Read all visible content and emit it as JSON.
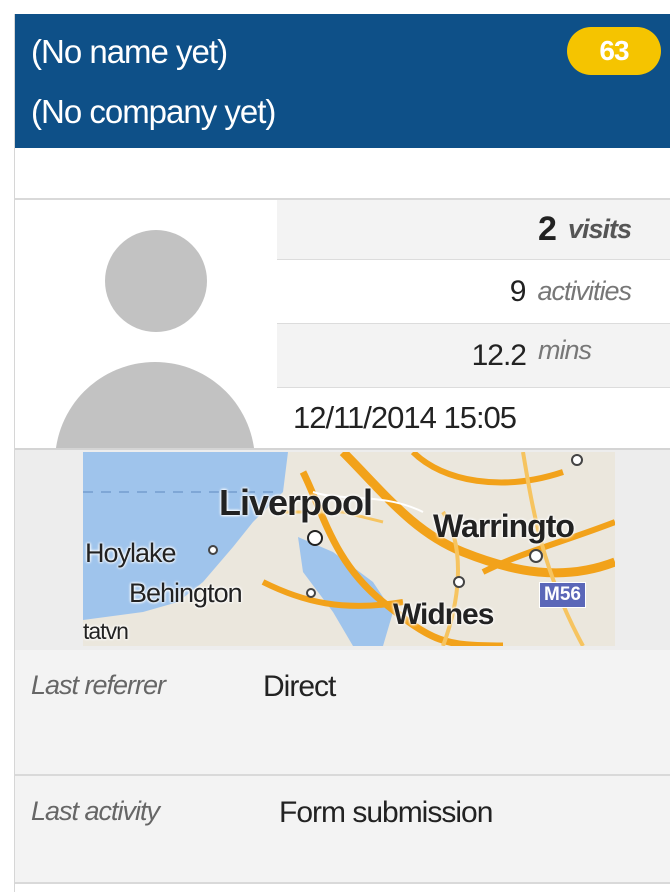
{
  "contact": {
    "name": "(No name yet)",
    "company": "(No company yet)",
    "score": "63"
  },
  "stats": {
    "visits": {
      "value": "2",
      "unit": "visits"
    },
    "activities": {
      "value": "9",
      "unit": "activities"
    },
    "time": {
      "value": "12.2",
      "unit": "mins"
    },
    "last_seen": "12/11/2014 15:05"
  },
  "map": {
    "places": [
      "Liverpool",
      "Warringto",
      "Hoylake",
      "Behington",
      "Widnes",
      "tatvn"
    ],
    "road_badge": "M56",
    "colors": {
      "water": "#9fc4ec",
      "land": "#ebe7dd",
      "road": "#f2a21a"
    }
  },
  "details": {
    "referrer_label": "Last referrer",
    "referrer_value": "Direct",
    "activity_label": "Last activity",
    "activity_value": "Form submission"
  },
  "colors": {
    "header": "#0e5088",
    "badge": "#f5c400",
    "avatar": "#c2c2c2"
  }
}
